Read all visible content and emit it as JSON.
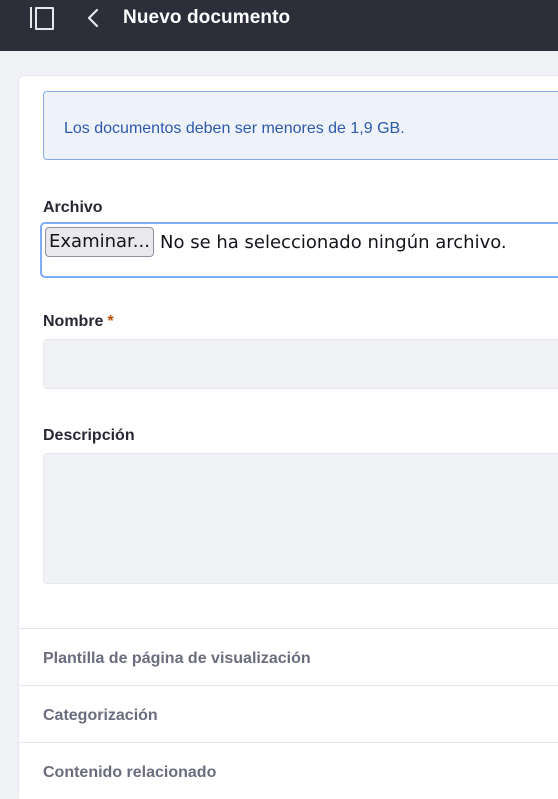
{
  "header": {
    "title": "Nuevo documento",
    "icons": [
      "sidebar-toggle-icon",
      "chevron-left-icon"
    ]
  },
  "alert": {
    "text": "Los documentos deben ser menores de 1,9 GB."
  },
  "form": {
    "file": {
      "label": "Archivo",
      "button_label": "Examinar...",
      "status": "No se ha seleccionado ningún archivo."
    },
    "name": {
      "label": "Nombre",
      "required_mark": "*",
      "value": ""
    },
    "description": {
      "label": "Descripción",
      "value": ""
    }
  },
  "panels": [
    {
      "label": "Plantilla de página de visualización"
    },
    {
      "label": "Categorización"
    },
    {
      "label": "Contenido relacionado"
    }
  ],
  "colors": {
    "topbar": "#2c2e3a",
    "alert_bg": "#eef2fa",
    "alert_text": "#2e5aac",
    "required": "#b95000",
    "focus_border": "#80acff"
  }
}
